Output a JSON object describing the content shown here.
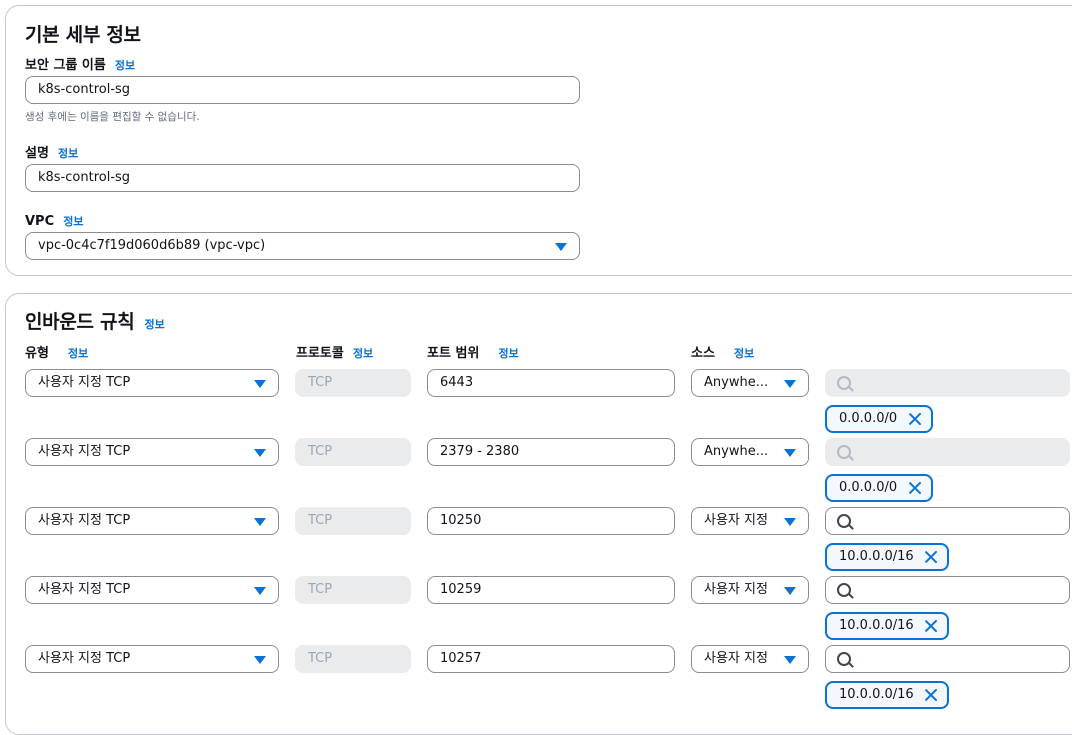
{
  "basic_details": {
    "title": "기본 세부 정보",
    "name_label": "보안 그룹 이름",
    "name_info": "정보",
    "name_value": "k8s-control-sg",
    "name_hint": "생성 후에는 이름을 편집할 수 없습니다.",
    "desc_label": "설명",
    "desc_info": "정보",
    "desc_value": "k8s-control-sg",
    "vpc_label": "VPC",
    "vpc_info": "정보",
    "vpc_value": "vpc-0c4c7f19d060d6b89 (vpc-vpc)"
  },
  "inbound": {
    "title": "인바운드 규칙",
    "title_info": "정보",
    "columns": {
      "type": "유형",
      "type_info": "정보",
      "protocol": "프로토콜",
      "protocol_info": "정보",
      "port": "포트 범위",
      "port_info": "정보",
      "source": "소스",
      "source_info": "정보"
    },
    "rules": [
      {
        "type": "사용자 지정 TCP",
        "protocol": "TCP",
        "port": "6443",
        "source": "Anywhe...",
        "cidr": "0.0.0.0/0"
      },
      {
        "type": "사용자 지정 TCP",
        "protocol": "TCP",
        "port": "2379 - 2380",
        "source": "Anywhe...",
        "cidr": "0.0.0.0/0"
      },
      {
        "type": "사용자 지정 TCP",
        "protocol": "TCP",
        "port": "10250",
        "source": "사용자 지정",
        "cidr": "10.0.0.0/16"
      },
      {
        "type": "사용자 지정 TCP",
        "protocol": "TCP",
        "port": "10259",
        "source": "사용자 지정",
        "cidr": "10.0.0.0/16"
      },
      {
        "type": "사용자 지정 TCP",
        "protocol": "TCP",
        "port": "10257",
        "source": "사용자 지정",
        "cidr": "10.0.0.0/16"
      }
    ]
  },
  "colors": {
    "accent": "#0972d3",
    "disabled_bg": "#e9ebed",
    "border": "#8c8c94"
  },
  "icons": [
    "chevron-down-icon",
    "search-icon",
    "close-icon"
  ]
}
